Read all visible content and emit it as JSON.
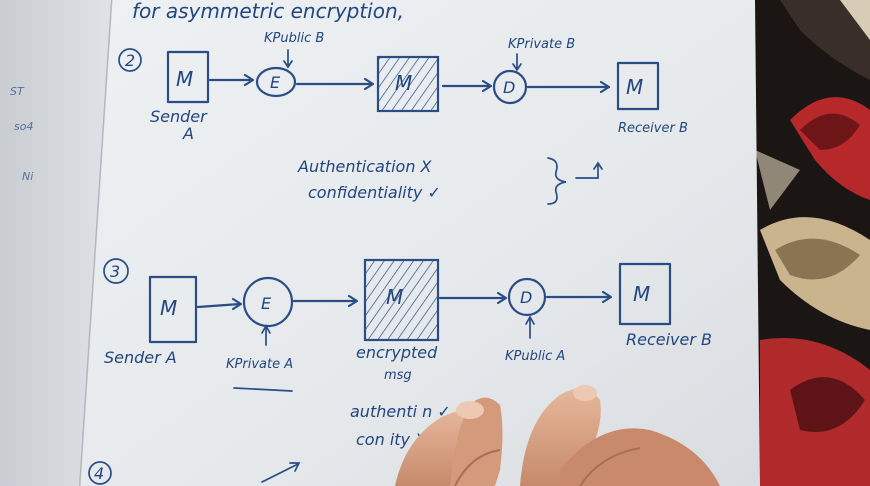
{
  "photo": {
    "header_text": "for asymmetric encryption,",
    "scheme2": {
      "number": "2",
      "sender_box": "M",
      "sender_label": "Sender",
      "sender_label_2": "A",
      "encrypt": "E",
      "encrypt_key": "KPublic B",
      "cipher_box": "M",
      "decrypt": "D",
      "decrypt_key": "KPrivate B",
      "receiver_box": "M",
      "receiver_label": "Receiver B",
      "auth_line": "Authentication X",
      "conf_line": "confidentiality ✓"
    },
    "scheme3": {
      "number": "3",
      "sender_box": "M",
      "sender_label": "Sender A",
      "encrypt": "E",
      "encrypt_key": "KPrivate A",
      "cipher_box": "M",
      "cipher_label": "encrypted",
      "cipher_label_2": "msg",
      "decrypt": "D",
      "decrypt_key": "KPublic A",
      "receiver_box": "M",
      "receiver_label": "Receiver B",
      "auth_line": "authenti    n ✓",
      "conf_line": "con        ity X"
    },
    "scheme4_number": "4",
    "colors": {
      "ink": "#2a4d86",
      "paper": "#e9ecef",
      "skin": "#d9a386",
      "rug_red": "#b7282b"
    }
  }
}
